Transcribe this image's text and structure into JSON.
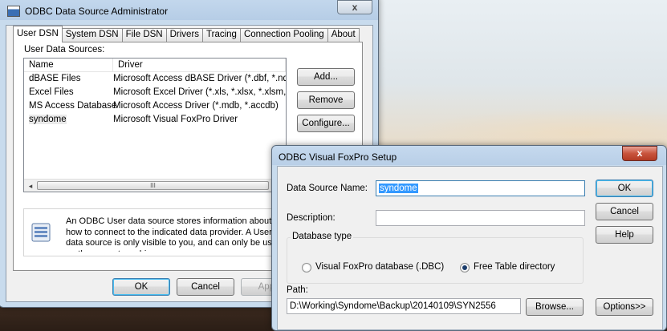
{
  "main_window": {
    "title": "ODBC Data Source Administrator",
    "close": "x",
    "tabs": [
      "User DSN",
      "System DSN",
      "File DSN",
      "Drivers",
      "Tracing",
      "Connection Pooling",
      "About"
    ],
    "user_data_sources_label": "User Data Sources:",
    "columns": {
      "name": "Name",
      "driver": "Driver"
    },
    "rows": [
      {
        "name": "dBASE Files",
        "driver": "Microsoft Access dBASE Driver (*.dbf, *.ndx"
      },
      {
        "name": "Excel Files",
        "driver": "Microsoft Excel Driver (*.xls, *.xlsx, *.xlsm, *.x"
      },
      {
        "name": "MS Access Database",
        "driver": "Microsoft Access Driver (*.mdb, *.accdb)"
      },
      {
        "name": "syndome",
        "driver": "Microsoft Visual FoxPro Driver"
      }
    ],
    "scroll": {
      "left": "◂",
      "thumb": "III"
    },
    "buttons": {
      "add": "Add...",
      "remove": "Remove",
      "configure": "Configure..."
    },
    "info_text": "An ODBC User data source stores information about how to connect to the indicated data provider.   A User data source is only visible to you, and can only be used on the current machine.",
    "bottom_buttons": {
      "ok": "OK",
      "cancel": "Cancel",
      "apply": "Apply"
    }
  },
  "setup_dialog": {
    "title": "ODBC Visual FoxPro Setup",
    "close": "x",
    "data_source_name_label": "Data Source Name:",
    "data_source_name_value": "syndome",
    "description_label": "Description:",
    "description_value": "",
    "database_type_label": "Database type",
    "radio_dbc": "Visual FoxPro database (.DBC)",
    "radio_free": "Free Table directory",
    "selected_type": "Free Table directory",
    "path_label": "Path:",
    "path_value": "D:\\Working\\Syndome\\Backup\\20140109\\SYN2556",
    "buttons": {
      "ok": "OK",
      "cancel": "Cancel",
      "help": "Help",
      "browse": "Browse...",
      "options": "Options>>"
    }
  }
}
